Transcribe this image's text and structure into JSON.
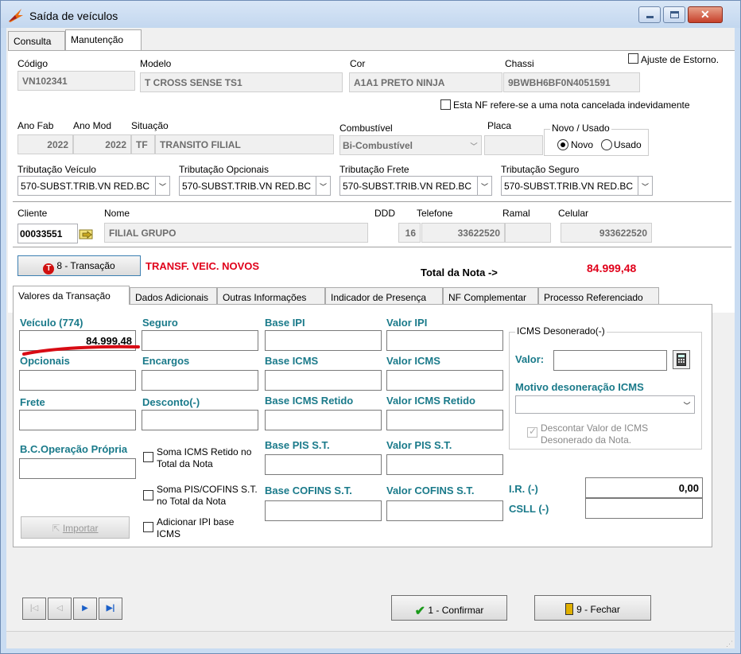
{
  "window": {
    "title": "Saída de veículos"
  },
  "tabs": [
    "Consulta",
    "Manutenção"
  ],
  "header": {
    "codigo_label": "Código",
    "codigo": "VN102341",
    "modelo_label": "Modelo",
    "modelo": "T CROSS SENSE TS1",
    "cor_label": "Cor",
    "cor": "A1A1 PRETO NINJA",
    "chassi_label": "Chassi",
    "chassi": "9BWBH6BF0N4051591",
    "ajuste_label": "Ajuste  de Estorno.",
    "nf_cancelada_label": "Esta NF refere-se a uma nota cancelada indevidamente",
    "ano_fab_label": "Ano Fab",
    "ano_fab": "2022",
    "ano_mod_label": "Ano Mod",
    "ano_mod": "2022",
    "situacao_label": "Situação",
    "situacao_code": "TF",
    "situacao": "TRANSITO FILIAL",
    "combustivel_label": "Combustível",
    "combustivel": "Bi-Combustível",
    "placa_label": "Placa",
    "placa": "",
    "novo_usado_label": "Novo / Usado",
    "novo_label": "Novo",
    "usado_label": "Usado",
    "trib_veiculo_label": "Tributação Veículo",
    "trib_veiculo": "570-SUBST.TRIB.VN RED.BC",
    "trib_opcionais_label": "Tributação Opcionais",
    "trib_opcionais": "570-SUBST.TRIB.VN RED.BC",
    "trib_frete_label": "Tributação Frete",
    "trib_frete": "570-SUBST.TRIB.VN RED.BC",
    "trib_seguro_label": "Tributação Seguro",
    "trib_seguro": "570-SUBST.TRIB.VN RED.BC",
    "cliente_label": "Cliente",
    "cliente": "00033551",
    "nome_label": "Nome",
    "nome": "FILIAL GRUPO",
    "ddd_label": "DDD",
    "ddd": "16",
    "telefone_label": "Telefone",
    "telefone": "33622520",
    "ramal_label": "Ramal",
    "ramal": "",
    "celular_label": "Celular",
    "celular": "933622520"
  },
  "transacao": {
    "button_label": "8 - Transação",
    "tipo": "TRANSF. VEIC. NOVOS",
    "total_label": "Total da Nota ->",
    "total": "84.999,48"
  },
  "subtabs": [
    "Valores da Transação",
    "Dados Adicionais",
    "Outras Informações",
    "Indicador de Presença",
    "NF Complementar",
    "Processo Referenciado"
  ],
  "valores": {
    "veiculo_label": "Veículo (774)",
    "veiculo": "84.999,48",
    "seguro_label": "Seguro",
    "base_ipi_label": "Base IPI",
    "valor_ipi_label": "Valor IPI",
    "opcionais_label": "Opcionais",
    "encargos_label": "Encargos",
    "base_icms_label": "Base ICMS",
    "valor_icms_label": "Valor ICMS",
    "frete_label": "Frete",
    "desconto_label": "Desconto(-)",
    "base_icms_retido_label": "Base ICMS Retido",
    "valor_icms_retido_label": "Valor ICMS Retido",
    "bc_operacao_label": "B.C.Operação Própria",
    "soma_icms_label": "Soma ICMS Retido no Total da Nota",
    "base_pis_label": "Base PIS S.T.",
    "valor_pis_label": "Valor PIS S.T.",
    "soma_pis_label": "Soma  PIS/COFINS S.T. no Total da Nota",
    "base_cofins_label": "Base COFINS S.T.",
    "valor_cofins_label": "Valor COFINS S.T.",
    "adicionar_ipi_label": "Adicionar IPI base ICMS",
    "importar_label": "Importar",
    "icms_deson_label": "ICMS Desonerado(-)",
    "valor_label": "Valor:",
    "motivo_label": "Motivo desoneração ICMS",
    "descontar_label": "Descontar Valor de ICMS Desonerado da Nota.",
    "ir_label": "I.R. (-)",
    "ir": "0,00",
    "csll_label": "CSLL (-)"
  },
  "footer": {
    "confirmar_label": "1 - Confirmar",
    "fechar_label": "9 - Fechar"
  },
  "colors": {
    "teal": "#1a7a8a",
    "red": "#e0001a",
    "window_frame": "#c9dcf2"
  }
}
